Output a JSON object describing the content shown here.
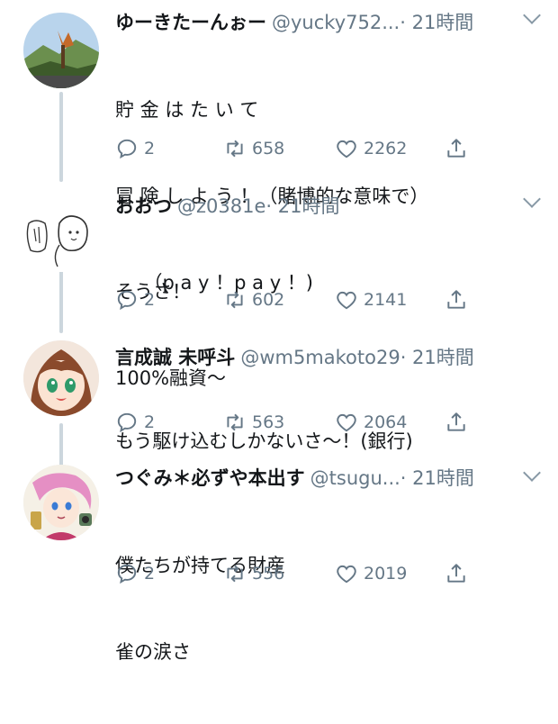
{
  "tweets": [
    {
      "display_name": "ゆーきたーんぉー",
      "handle": "@yucky752...",
      "time": "· 21時間",
      "lines": [
        "貯 金 は た い て",
        "冒 険 し よ う ！（賭博的な意味で）",
        "　　（p a y ！p a y ！)"
      ],
      "replies": "2",
      "retweets": "658",
      "likes": "2262",
      "avatar_icon": "landscape-avatar-icon"
    },
    {
      "display_name": "おおつ",
      "handle": "@z0381e",
      "time": "· 21時間",
      "lines": [
        "そうさ！",
        "100%融資〜"
      ],
      "replies": "2",
      "retweets": "602",
      "likes": "2141",
      "avatar_icon": "sketch-character-avatar-icon"
    },
    {
      "display_name": "言成誠 未呼斗",
      "handle": "@wm5makoto29",
      "time": "· 21時間",
      "lines": [
        "もう駆け込むしかないさ〜！(銀行)"
      ],
      "replies": "2",
      "retweets": "563",
      "likes": "2064",
      "avatar_icon": "anime-girl-avatar-icon"
    },
    {
      "display_name": "つぐみ＊必ずや本出す",
      "handle": "@tsugu...",
      "time": "· 21時間",
      "lines": [
        "僕たちが持てる財産",
        "雀の涙さ"
      ],
      "replies": "2",
      "retweets": "556",
      "likes": "2019",
      "avatar_icon": "illustration-avatar-icon"
    }
  ],
  "colors": {
    "text": "#14171a",
    "secondary": "#657786",
    "thread_line": "#ccd6dd"
  }
}
